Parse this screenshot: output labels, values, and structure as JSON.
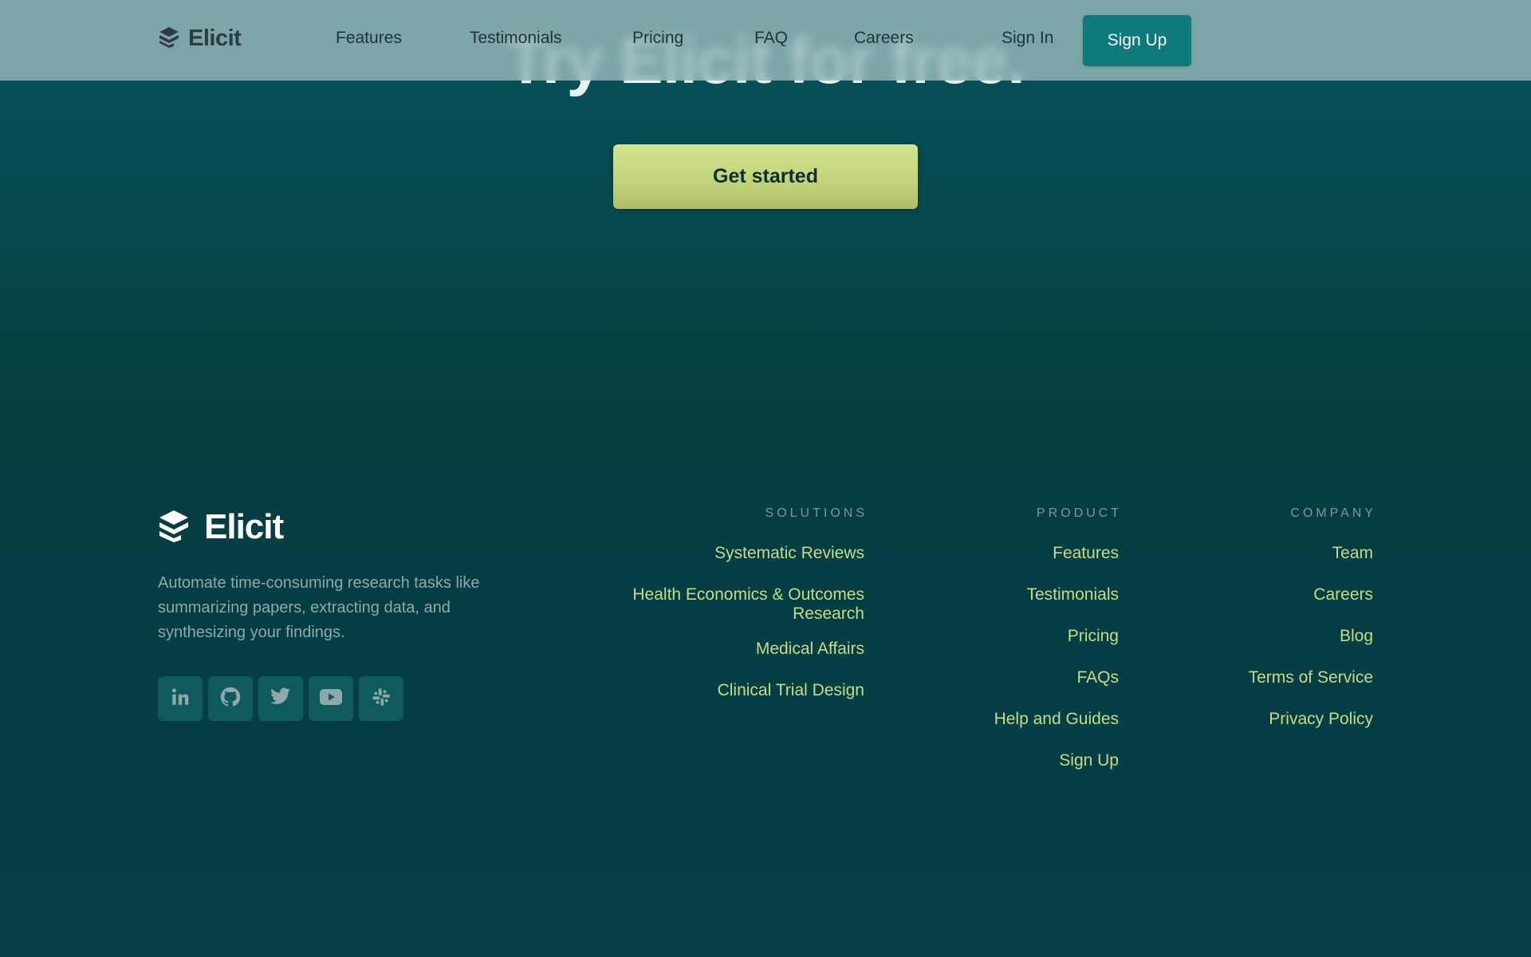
{
  "header": {
    "logo_text": "Elicit",
    "nav": [
      {
        "label": "Features"
      },
      {
        "label": "Testimonials"
      },
      {
        "label": "Pricing"
      },
      {
        "label": "FAQ"
      },
      {
        "label": "Careers"
      }
    ],
    "sign_in_label": "Sign In",
    "sign_up_label": "Sign Up"
  },
  "hero": {
    "title": "Try Elicit for free.",
    "cta_label": "Get started"
  },
  "footer": {
    "logo_text": "Elicit",
    "tagline": "Automate time-consuming research tasks like summarizing papers, extracting data, and synthesizing your findings.",
    "social": [
      {
        "icon": "linkedin-icon"
      },
      {
        "icon": "github-icon"
      },
      {
        "icon": "twitter-icon"
      },
      {
        "icon": "youtube-icon"
      },
      {
        "icon": "slack-icon"
      }
    ],
    "columns": [
      {
        "heading": "SOLUTIONS",
        "links": [
          "Systematic Reviews",
          "Health Economics & Outcomes Research",
          "Medical Affairs",
          "Clinical Trial Design"
        ]
      },
      {
        "heading": "PRODUCT",
        "links": [
          "Features",
          "Testimonials",
          "Pricing",
          "FAQs",
          "Help and Guides",
          "Sign Up"
        ]
      },
      {
        "heading": "COMPANY",
        "links": [
          "Team",
          "Careers",
          "Blog",
          "Terms of Service",
          "Privacy Policy"
        ]
      }
    ]
  },
  "colors": {
    "accent_teal": "#0e7a7c",
    "cta_green": "#c9db82",
    "link_green": "#c6db84",
    "background": "#053f45"
  }
}
